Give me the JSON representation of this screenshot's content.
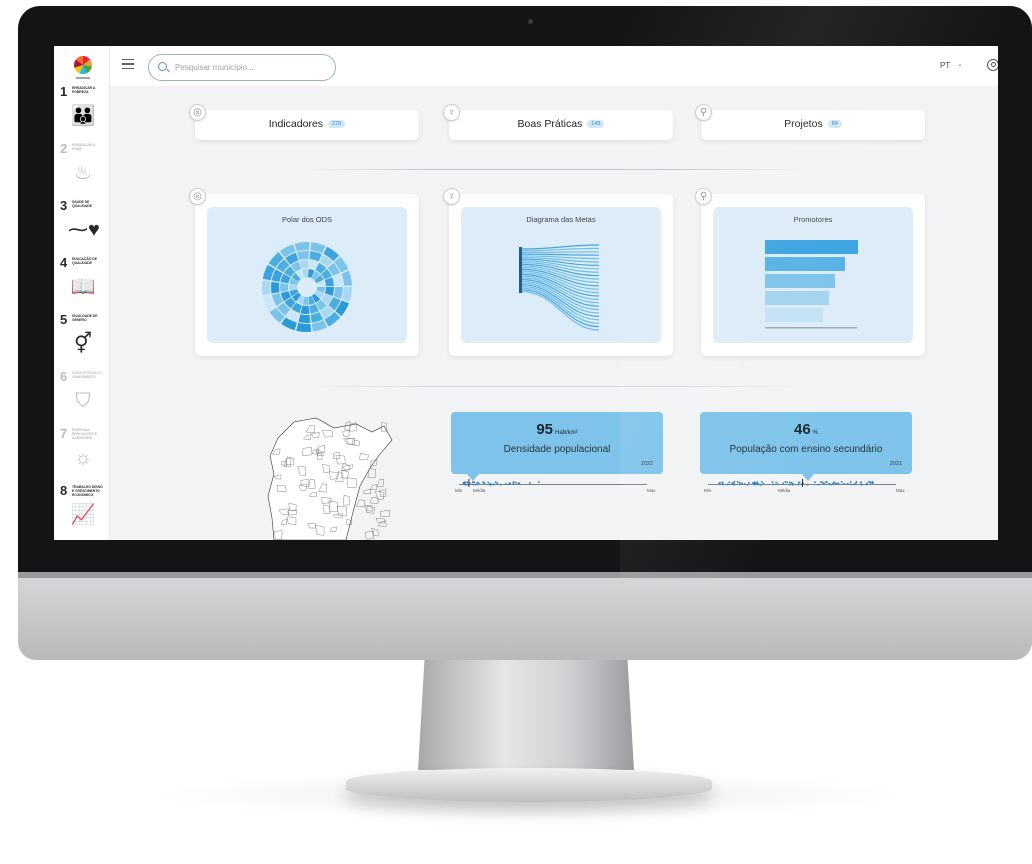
{
  "topbar": {
    "search_placeholder": "Pesquisar município...",
    "language": "PT",
    "language_chevron": "⌄"
  },
  "sidebar": {
    "items": [
      {
        "number": "1",
        "label": "ERRADICAR A POBREZA",
        "icon": "family-icon",
        "glyph": "👪",
        "active": true
      },
      {
        "number": "2",
        "label": "ERRADICAR A FOME",
        "icon": "bowl-icon",
        "glyph": "♨",
        "active": false
      },
      {
        "number": "3",
        "label": "SAÚDE DE QUALIDADE",
        "icon": "heartbeat-icon",
        "glyph": "⁓♥",
        "active": true
      },
      {
        "number": "4",
        "label": "EDUCAÇÃO DE QUALIDADE",
        "icon": "book-icon",
        "glyph": "📖",
        "active": true
      },
      {
        "number": "5",
        "label": "IGUALDADE DE GÉNERO",
        "icon": "gender-icon",
        "glyph": "⚥",
        "active": true
      },
      {
        "number": "6",
        "label": "ÁGUA POTÁVEL E SANEAMENTO",
        "icon": "water-icon",
        "glyph": "⛉",
        "active": false
      },
      {
        "number": "7",
        "label": "ENERGIAS RENOVÁVEIS E ACESSÍVEIS",
        "icon": "sun-icon",
        "glyph": "☼",
        "active": false
      },
      {
        "number": "8",
        "label": "TRABALHO DIGNO E CRESCIMENTO ECONÓMICO",
        "icon": "growth-icon",
        "glyph": "📈",
        "active": true
      }
    ]
  },
  "tabs": [
    {
      "label": "Indicadores",
      "count": "270"
    },
    {
      "label": "Boas Práticas",
      "count": "143"
    },
    {
      "label": "Projetos",
      "count": "84"
    }
  ],
  "cards": [
    {
      "title": "Polar dos ODS"
    },
    {
      "title": "Diagrama das Metas"
    },
    {
      "title": "Promotores"
    }
  ],
  "stats": [
    {
      "value": "95",
      "unit": "Hab/km²",
      "label": "Densidade populacional",
      "year": "2022",
      "min": "Min",
      "mid": "Média",
      "max": "Max",
      "marker_fraction": 0.05
    },
    {
      "value": "46",
      "unit": "%",
      "label": "População com ensino secundário",
      "year": "2021",
      "min": "Min",
      "mid": "Média",
      "max": "Max",
      "marker_fraction": 0.5
    }
  ],
  "colors": {
    "accent": "#7ec4ea",
    "card_fill": "#dcecf8",
    "bar_dark": "#3aa3e0"
  }
}
